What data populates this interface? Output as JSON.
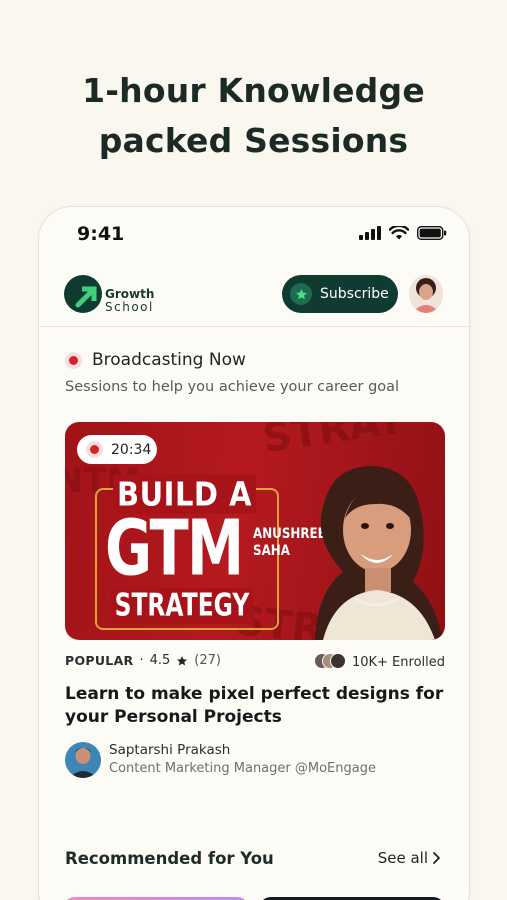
{
  "headline": {
    "line1": "1-hour Knowledge",
    "line2": "packed Sessions"
  },
  "status_bar": {
    "time": "9:41"
  },
  "app_bar": {
    "logo_line1": "Growth",
    "logo_line2": "School",
    "subscribe_label": "Subscribe"
  },
  "broadcast": {
    "title": "Broadcasting Now",
    "subtitle": "Sessions to help you achieve your career goal"
  },
  "session": {
    "timer": "20:34",
    "banner_line1": "BUILD A",
    "banner_line2": "GTM",
    "banner_line3": "STRATEGY",
    "speaker_first": "ANUSHREE",
    "speaker_last": "SAHA",
    "tag": "POPULAR",
    "separator": "·",
    "rating": "4.5",
    "review_count": "(27)",
    "enrolled": "10K+ Enrolled",
    "title": "Learn to make pixel perfect designs for your Personal Projects",
    "author_name": "Saptarshi Prakash",
    "author_role": "Content Marketing Manager @MoEngage"
  },
  "recommended": {
    "title": "Recommended for You",
    "see_all": "See all"
  },
  "colors": {
    "brand_green": "#0f3b31",
    "live_red": "#d2232a",
    "banner_red": "#b51a1f",
    "background": "#faf7ef"
  }
}
